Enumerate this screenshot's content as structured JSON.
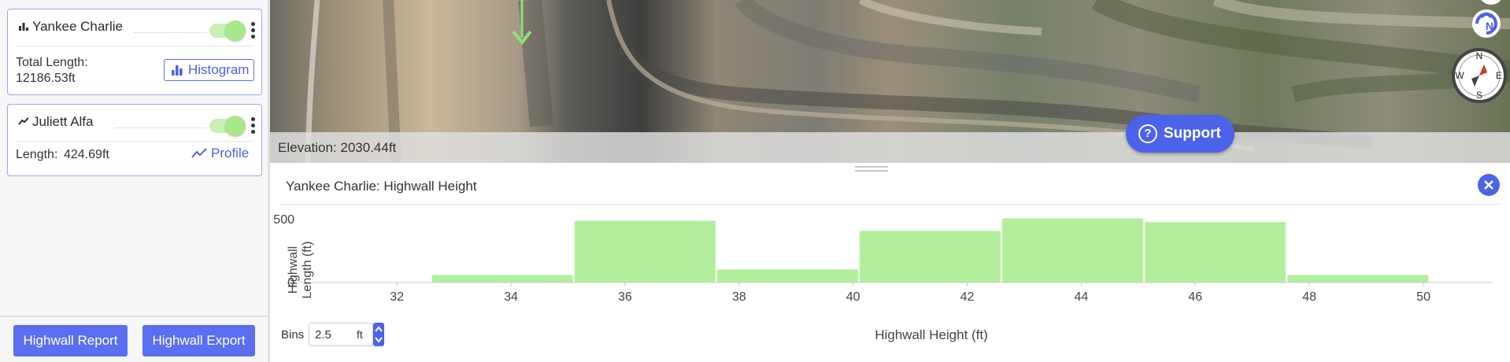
{
  "layers": [
    {
      "name": "Yankee Charlie",
      "icon": "bar-chart-icon",
      "enabled": true,
      "stat_label": "Total Length:",
      "stat_value": "12186.53ft",
      "action_label": "Histogram"
    },
    {
      "name": "Juliett Alfa",
      "icon": "line-chart-icon",
      "enabled": true,
      "stat_label": "Length:",
      "stat_value": "424.69ft",
      "action_label": "Profile"
    }
  ],
  "footer": {
    "report_label": "Highwall Report",
    "export_label": "Highwall Export"
  },
  "map": {
    "elevation_text": "Elevation: 2030.44ft",
    "support_label": "Support",
    "compass": [
      "N",
      "E",
      "S",
      "W"
    ]
  },
  "chart_panel": {
    "title": "Yankee Charlie: Highwall Height",
    "bins_label": "Bins",
    "bins_value": "2.5",
    "bins_unit": "ft"
  },
  "chart_data": {
    "type": "bar",
    "title": "Yankee Charlie: Highwall Height",
    "xlabel": "Highwall Height (ft)",
    "ylabel": "Highwall Length (ft)",
    "xlim": [
      30.3,
      51.2
    ],
    "ylim": [
      0,
      500
    ],
    "x_ticks": [
      "32",
      "34",
      "36",
      "38",
      "40",
      "42",
      "44",
      "46",
      "48",
      "50"
    ],
    "y_ticks": [
      "0",
      "500"
    ],
    "bin_width": 2.5,
    "bins": [
      {
        "from": 32.6,
        "to": 35.1,
        "value": 60
      },
      {
        "from": 35.1,
        "to": 37.6,
        "value": 490
      },
      {
        "from": 37.6,
        "to": 40.1,
        "value": 105
      },
      {
        "from": 40.1,
        "to": 42.6,
        "value": 410
      },
      {
        "from": 42.6,
        "to": 45.1,
        "value": 510
      },
      {
        "from": 45.1,
        "to": 47.6,
        "value": 480
      },
      {
        "from": 47.6,
        "to": 50.1,
        "value": 60
      }
    ],
    "color": "#b2ee9b",
    "grid": false,
    "legend": "none"
  },
  "colors": {
    "accent": "#4b63ea",
    "toggle": "#a7e88a",
    "bar": "#b2ee9b"
  }
}
